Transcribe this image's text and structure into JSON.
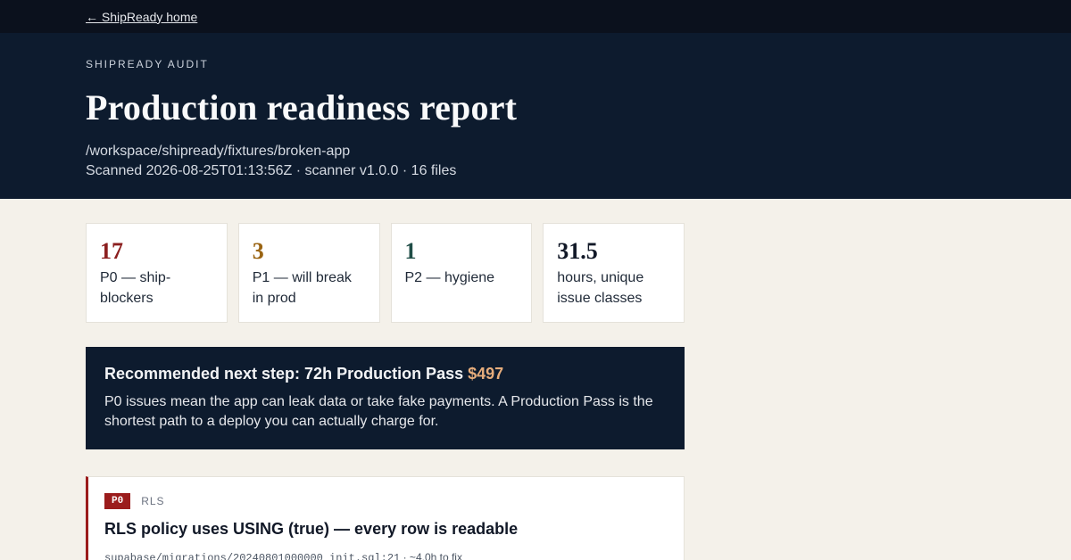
{
  "nav": {
    "home_link": "← ShipReady home"
  },
  "hero": {
    "eyebrow": "SHIPREADY AUDIT",
    "title": "Production readiness report",
    "path": "/workspace/shipready/fixtures/broken-app",
    "scan_line": "Scanned 2026-08-25T01:13:56Z · scanner v1.0.0 · 16 files"
  },
  "stats": [
    {
      "value": "17",
      "label": "P0 — ship-blockers",
      "color": "#8b1e1e"
    },
    {
      "value": "3",
      "label": "P1 — will break in prod",
      "color": "#9a6412"
    },
    {
      "value": "1",
      "label": "P2 — hygiene",
      "color": "#1f4d46"
    },
    {
      "value": "31.5",
      "label": "hours, unique issue classes",
      "color": "#111827"
    }
  ],
  "cta": {
    "title": "Recommended next step: 72h Production Pass ",
    "price": "$497",
    "body": "P0 issues mean the app can leak data or take fake payments. A Production Pass is the shortest path to a deploy you can actually charge for."
  },
  "issues": [
    {
      "severity": "P0",
      "category": "RLS",
      "title": "RLS policy uses USING (true) — every row is readable",
      "location": "supabase/migrations/20240801000000_init.sql:21",
      "estimate": " · ~4.0h to fix"
    }
  ]
}
